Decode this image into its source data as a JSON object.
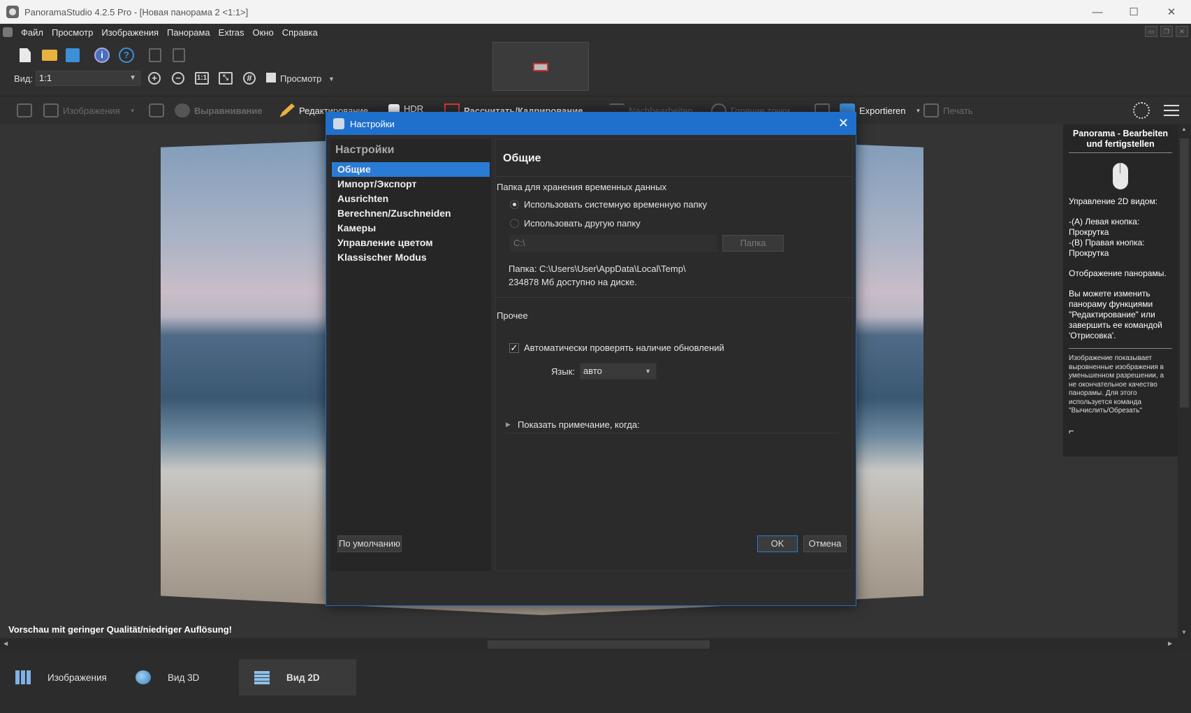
{
  "window": {
    "title": "PanoramaStudio 4.2.5 Pro - [Новая панорама 2 <1:1>]",
    "minimize": "—",
    "maximize": "☐",
    "close": "✕"
  },
  "menu": [
    "Файл",
    "Просмотр",
    "Изображения",
    "Панорама",
    "Extras",
    "Окно",
    "Справка"
  ],
  "toolbar": {
    "view_label": "Вид:",
    "view_value": "1:1",
    "preview_label": "Просмотр",
    "zoom_11": "1:1",
    "grid": "#"
  },
  "workflow": {
    "images": "Изображения",
    "align": "Выравнивание",
    "edit": "Редактирование",
    "hdr": "HDR",
    "render": "Рассчитать/Кадрирование",
    "postprocess": "Nachbearbeiten",
    "hotspots": "Горячие точки",
    "export": "Exportieren",
    "print": "Печать"
  },
  "canvas": {
    "low_quality_notice": "Vorschau mit geringer Qualität/niedriger Auflösung!"
  },
  "right_panel": {
    "title": "Panorama - Bearbeiten und fertigstellen",
    "control_heading": "Управление 2D видом:",
    "left_button": "-(A) Левая кнопка: Прокрутка",
    "right_button": "-(B) Правая кнопка: Прокрутка",
    "display": "Отображение панорамы.",
    "hint": "Вы можете изменить панораму функциями \"Редактирование\" или завершить ее командой 'Отрисовка'.",
    "small": "Изображение показывает выровненные изображения в уменьшенном разрешении, а не окончательное качество панорамы. Для этого используется команда \"Вычислить/Обрезать\"",
    "corner": "⌐"
  },
  "tabs": [
    {
      "label": "Изображения"
    },
    {
      "label": "Вид 3D"
    },
    {
      "label": "Вид 2D"
    }
  ],
  "dialog": {
    "title": "Настройки",
    "close": "✕",
    "nav_header": "Настройки",
    "nav": [
      "Общие",
      "Импорт/Экспорт",
      "Ausrichten",
      "Berechnen/Zuschneiden",
      "Камеры",
      "Управление цветом",
      "Klassischer Modus"
    ],
    "page_title": "Общие",
    "temp_group": "Папка для хранения временных данных",
    "radio_system": "Использовать системную временную папку",
    "radio_other": "Использовать другую папку",
    "folder_value": "C:\\",
    "folder_button": "Папка",
    "folder_path": "Папка: C:\\Users\\User\\AppData\\Local\\Temp\\",
    "disk_free": "234878 Мб доступно на диске.",
    "misc_group": "Прочее",
    "auto_update": "Автоматически проверять наличие обновлений",
    "auto_update_checked": true,
    "language_label": "Язык:",
    "language_value": "авто",
    "show_note": "Показать примечание, когда:",
    "default_button": "По умолчанию",
    "ok_button": "OK",
    "cancel_button": "Отмена"
  },
  "colors": {
    "accent": "#1f70cc",
    "selection": "#2a7bd6",
    "background": "#2b2b2b"
  }
}
